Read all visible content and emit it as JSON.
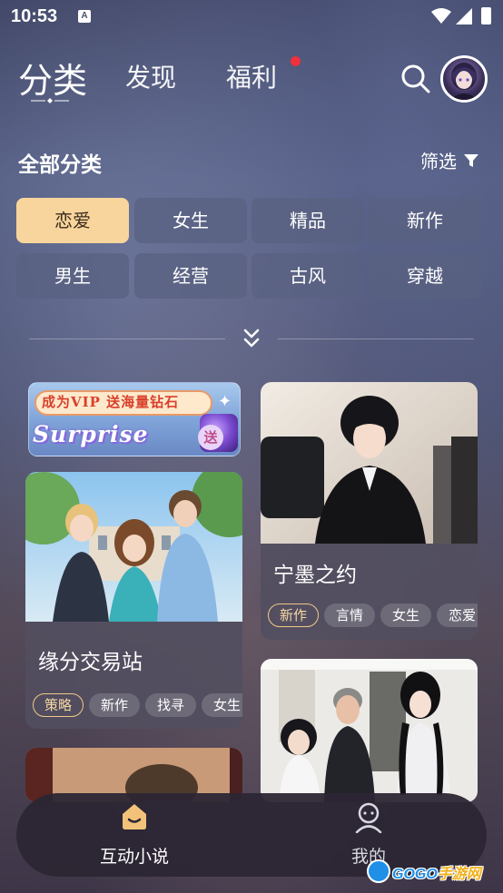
{
  "status": {
    "time": "10:53",
    "notification_badge": "A"
  },
  "nav": {
    "tabs": [
      {
        "label": "分类",
        "active": true
      },
      {
        "label": "发现",
        "active": false
      },
      {
        "label": "福利",
        "active": false,
        "has_dot": true
      }
    ]
  },
  "section": {
    "title": "全部分类",
    "filter_label": "筛选"
  },
  "categories": [
    {
      "label": "恋爱",
      "selected": true
    },
    {
      "label": "女生",
      "selected": false
    },
    {
      "label": "精品",
      "selected": false
    },
    {
      "label": "新作",
      "selected": false
    },
    {
      "label": "男生",
      "selected": false
    },
    {
      "label": "经营",
      "selected": false
    },
    {
      "label": "古风",
      "selected": false
    },
    {
      "label": "穿越",
      "selected": false
    }
  ],
  "banner": {
    "headline": "成为VIP 送海量钻石",
    "tagline": "Surprise",
    "badge": "送"
  },
  "novels": [
    {
      "title": "缘分交易站",
      "tags": [
        "策略",
        "新作",
        "找寻",
        "女生"
      ]
    },
    {
      "title": "宁墨之约",
      "tags": [
        "新作",
        "言情",
        "女生",
        "恋爱"
      ]
    }
  ],
  "bottom_nav": [
    {
      "label": "互动小说",
      "active": true
    },
    {
      "label": "我的",
      "active": false
    }
  ],
  "watermark": {
    "text": "GOGO",
    "accent": "手游网"
  },
  "colors": {
    "selected_chip": "#f8d59c",
    "chip_bg": "#5a6282",
    "tag_border": "#f0c888",
    "red_dot": "#f0303a",
    "bottom_bar": "#2c2634"
  }
}
